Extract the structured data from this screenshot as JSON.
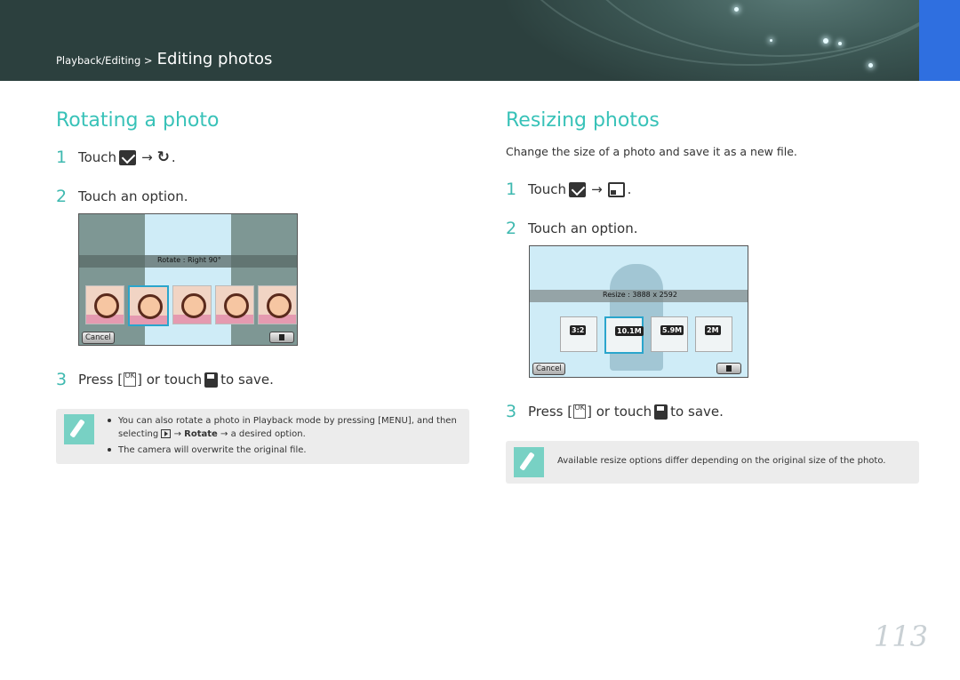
{
  "header": {
    "breadcrumb_small": "Playback/Editing >",
    "breadcrumb_big": "Editing photos"
  },
  "left": {
    "title": "Rotating a photo",
    "step1_num": "1",
    "step1_text": "Touch",
    "step1_arrow": "→",
    "step1_icon2": "↻",
    "step1_end": ".",
    "step2_num": "2",
    "step2_text": "Touch an option.",
    "screen": {
      "band_label": "Rotate : Right 90°",
      "cancel": "Cancel"
    },
    "step3_num": "3",
    "step3_a": "Press [",
    "step3_ok": "OK",
    "step3_b": "] or touch",
    "step3_c": "to save.",
    "note": {
      "line1": "You can also rotate a photo in Playback mode by pressing [MENU], and then",
      "line2a": "selecting",
      "line2_arrow1": "→",
      "line2_bold": "Rotate",
      "line2_arrow2": "→",
      "line2b": "a desired option.",
      "line3": "The camera will overwrite the original file."
    }
  },
  "right": {
    "title": "Resizing photos",
    "intro": "Change the size of a photo and save it as a new file.",
    "step1_num": "1",
    "step1_text": "Touch",
    "step1_arrow": "→",
    "step1_end": ".",
    "step2_num": "2",
    "step2_text": "Touch an option.",
    "screen": {
      "band_label": "Resize : 3888 x 2592",
      "cancel": "Cancel",
      "options": [
        "3:2",
        "10.1M",
        "5.9M",
        "2M"
      ]
    },
    "step3_num": "3",
    "step3_a": "Press [",
    "step3_ok": "OK",
    "step3_b": "] or touch",
    "step3_c": "to save.",
    "note": {
      "line1": "Available resize options differ depending on the original size of the photo."
    }
  },
  "page_number": "113",
  "colors": {
    "accent": "#38c2b8",
    "banner_tab": "#2f6fe0",
    "note_bg": "#ececec"
  }
}
